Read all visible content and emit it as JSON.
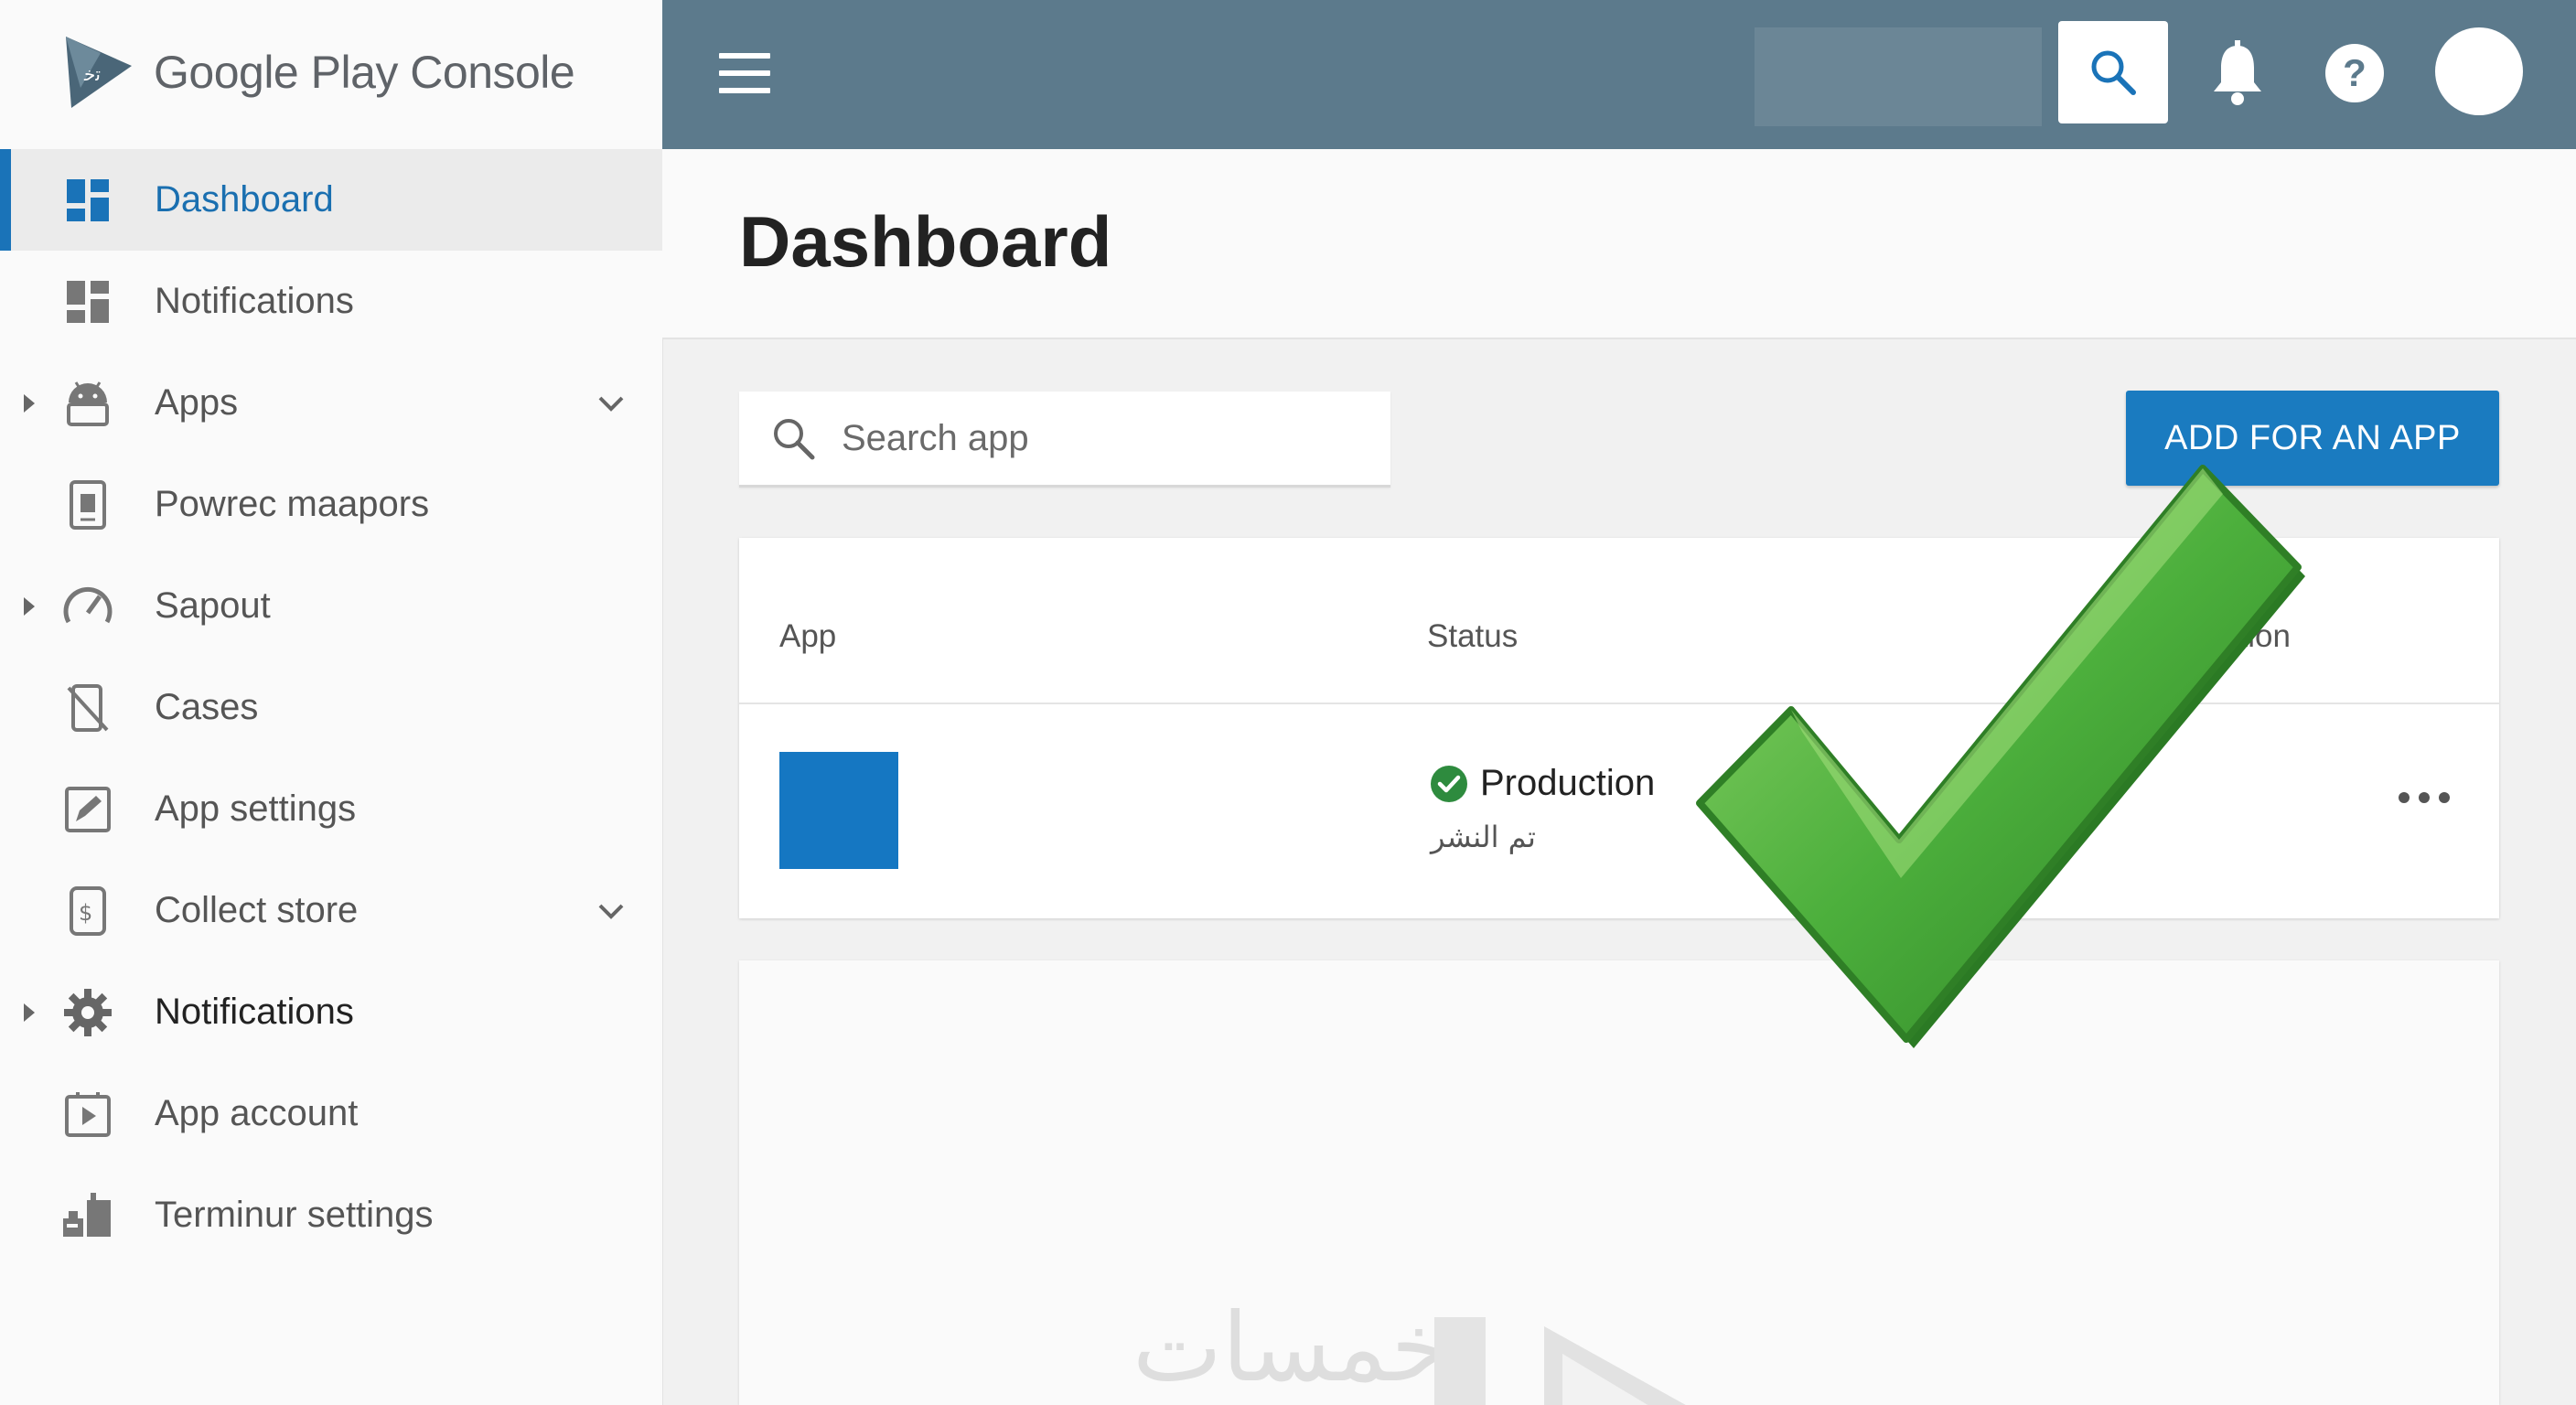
{
  "brand": {
    "name": "Google Play Console"
  },
  "sidebar": {
    "items": [
      {
        "label": "Dashboard",
        "icon": "dashboard-icon",
        "active": true
      },
      {
        "label": "Notifications",
        "icon": "notifications-grid-icon"
      },
      {
        "label": "Apps",
        "icon": "android-icon",
        "expandable": true
      },
      {
        "label": "Powrec maapors",
        "icon": "phone-document-icon"
      },
      {
        "label": "Sapout",
        "icon": "speedometer-icon",
        "expandable": true
      },
      {
        "label": "Cases",
        "icon": "phone-slash-icon"
      },
      {
        "label": "App settings",
        "icon": "edit-square-icon"
      },
      {
        "label": "Collect store",
        "icon": "phone-tag-icon",
        "expandable": true
      },
      {
        "label": "Notifications",
        "icon": "gear-icon",
        "expandable": true
      },
      {
        "label": "App account",
        "icon": "play-box-icon"
      },
      {
        "label": "Terminur settings",
        "icon": "terminal-settings-icon"
      }
    ]
  },
  "page": {
    "title": "Dashboard"
  },
  "search": {
    "placeholder": "Search app"
  },
  "actions": {
    "add_label": "ADD FOR AN APP"
  },
  "table": {
    "columns": [
      "App",
      "Status",
      "ction"
    ],
    "rows": [
      {
        "status": "Production",
        "status_sub": "تم النشر"
      }
    ]
  },
  "watermark": {
    "text": "خمسات"
  },
  "colors": {
    "topbar": "#5c7a8c",
    "accent": "#1a7bc0",
    "app_thumb": "#1577c2",
    "status_ok": "#2e8b3e",
    "checkmark": "#4caf3c"
  }
}
